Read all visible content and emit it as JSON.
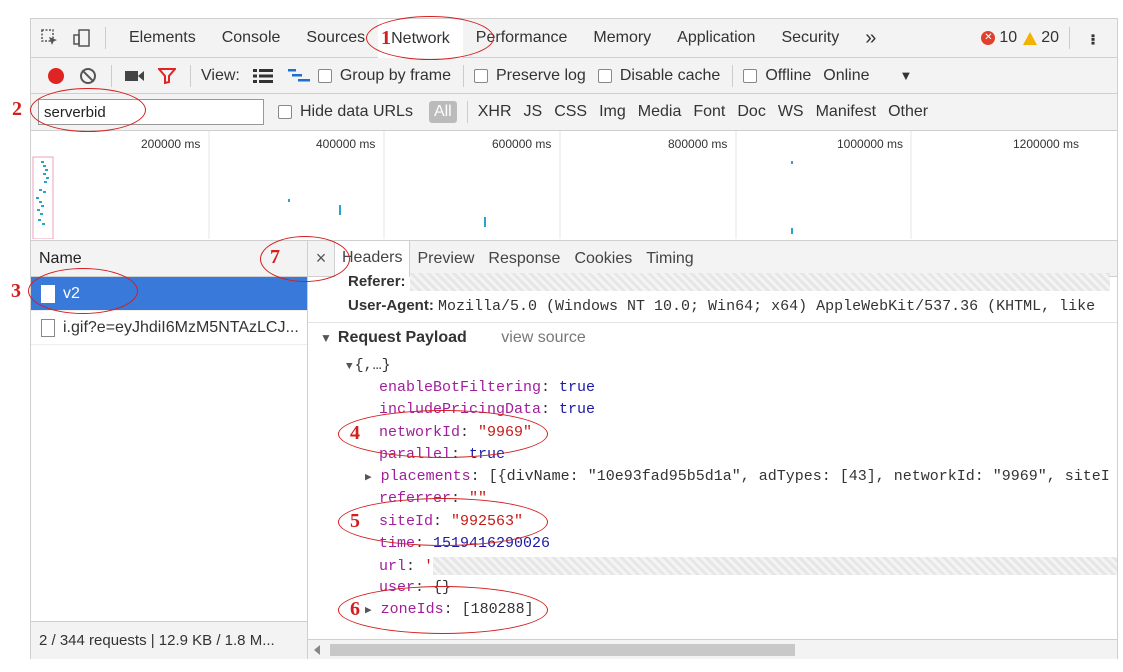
{
  "tabs": [
    "Elements",
    "Console",
    "Sources",
    "Network",
    "Performance",
    "Memory",
    "Application",
    "Security"
  ],
  "more_tabs": "»",
  "error_count": "10",
  "warning_count": "20",
  "toolbar": {
    "view_label": "View:",
    "group_by_frame": "Group by frame",
    "preserve_log": "Preserve log",
    "disable_cache": "Disable cache",
    "offline": "Offline",
    "throttle_value": "Online"
  },
  "filter": {
    "value": "serverbid",
    "hide_data_urls": "Hide data URLs",
    "types": [
      "All",
      "XHR",
      "JS",
      "CSS",
      "Img",
      "Media",
      "Font",
      "Doc",
      "WS",
      "Manifest",
      "Other"
    ]
  },
  "overview": {
    "ticks": [
      "200000 ms",
      "400000 ms",
      "600000 ms",
      "800000 ms",
      "1000000 ms",
      "1200000 ms"
    ]
  },
  "requests": {
    "column": "Name",
    "rows": [
      "v2",
      "i.gif?e=eyJhdiI6MzM5NTAzLCJ..."
    ],
    "status": "2 / 344 requests | 12.9 KB / 1.8 M..."
  },
  "detail": {
    "close": "×",
    "tabs": [
      "Headers",
      "Preview",
      "Response",
      "Cookies",
      "Timing"
    ],
    "referer_label": "Referer:",
    "user_agent_label": "User-Agent:",
    "user_agent_value": "Mozilla/5.0 (Windows NT 10.0; Win64; x64) AppleWebKit/537.36 (KHTML, like",
    "payload_title": "Request Payload",
    "view_source": "view source",
    "root": "{,…}",
    "payload": [
      {
        "key": "enableBotFiltering",
        "value": "true",
        "kind": "bool"
      },
      {
        "key": "includePricingData",
        "value": "true",
        "kind": "bool"
      },
      {
        "key": "networkId",
        "value": "\"9969\"",
        "kind": "str"
      },
      {
        "key": "parallel",
        "value": "true",
        "kind": "bool"
      },
      {
        "key": "placements",
        "value": "[{divName: \"10e93fad95b5d1a\", adTypes: [43], networkId: \"9969\", siteI",
        "kind": "plain"
      },
      {
        "key": "referrer",
        "value": "\"\"",
        "kind": "str"
      },
      {
        "key": "siteId",
        "value": "\"992563\"",
        "kind": "str"
      },
      {
        "key": "time",
        "value": "1519416290026",
        "kind": "num"
      },
      {
        "key": "url",
        "value": "'",
        "kind": "str"
      },
      {
        "key": "user",
        "value": "{}",
        "kind": "plain"
      },
      {
        "key": "zoneIds",
        "value": "[180288]",
        "kind": "plain"
      }
    ]
  },
  "annotations": [
    "1",
    "2",
    "3",
    "4",
    "5",
    "6",
    "7"
  ],
  "colors": {
    "annotation": "#d31e1e",
    "selected_row": "#3879d9",
    "record": "#e02424"
  }
}
